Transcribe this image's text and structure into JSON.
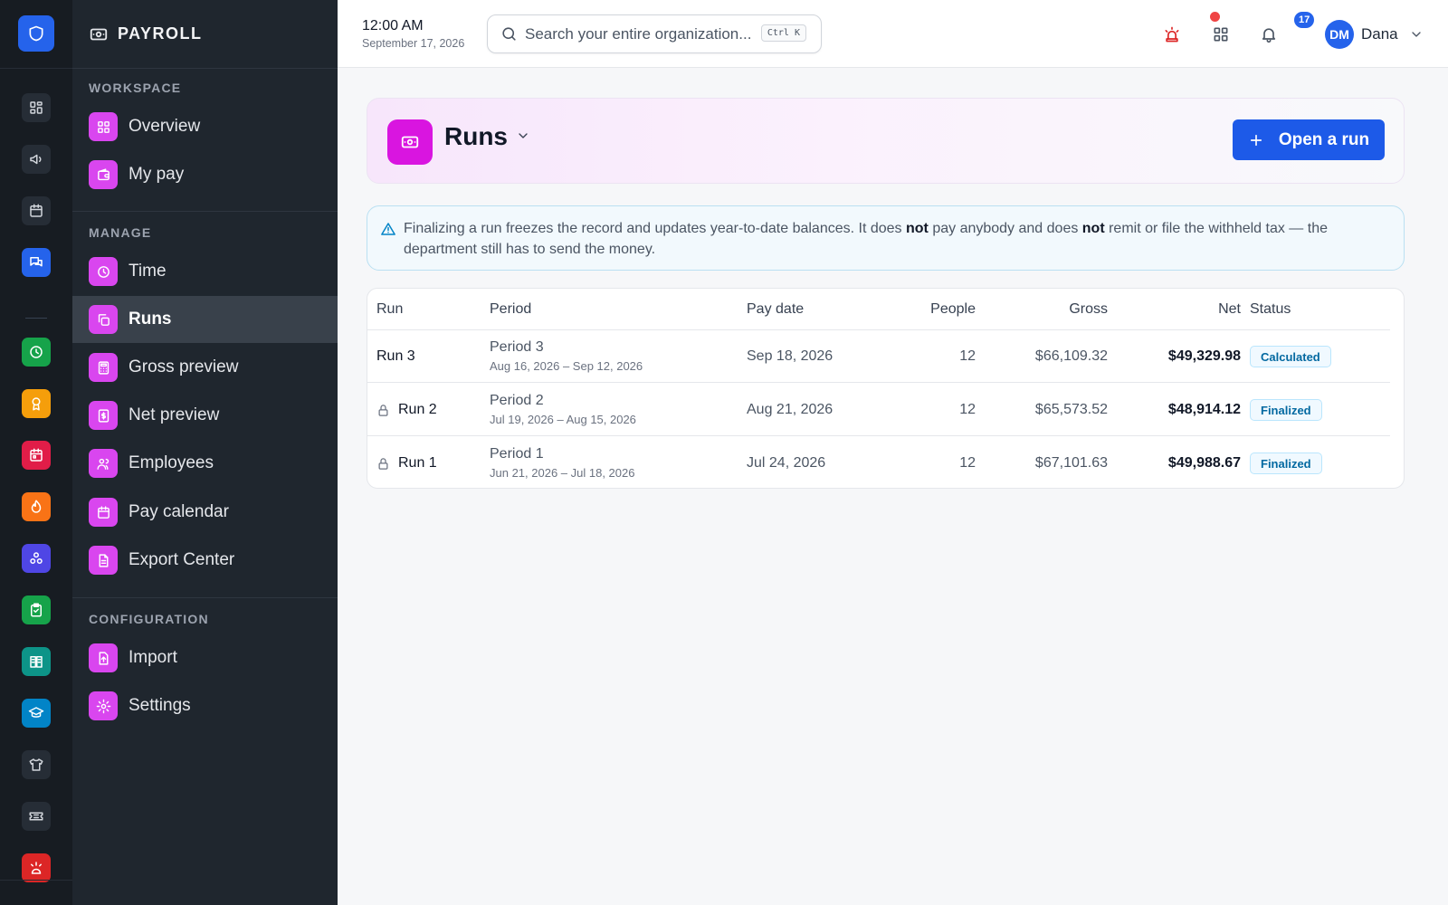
{
  "colors": {
    "accent": "#2563eb",
    "module": "#d946ef",
    "sidebar_bg": "#1f262e",
    "rail_bg": "#171c22",
    "status_text": "#0369a1"
  },
  "rail": {
    "items": [
      {
        "icon": "dashboard-icon",
        "color": "plain"
      },
      {
        "icon": "megaphone-icon",
        "color": "plain"
      },
      {
        "icon": "calendar-icon",
        "color": "plain"
      },
      {
        "icon": "chat-icon",
        "color": "#2563eb"
      },
      {
        "icon": "clock-icon",
        "color": "#16a34a"
      },
      {
        "icon": "award-icon",
        "color": "#f59e0b"
      },
      {
        "icon": "calendar-event-icon",
        "color": "#e11d48"
      },
      {
        "icon": "flame-icon",
        "color": "#f97316"
      },
      {
        "icon": "hierarchy-icon",
        "color": "#4f46e5"
      },
      {
        "icon": "clipboard-check-icon",
        "color": "#16a34a"
      },
      {
        "icon": "book-icon",
        "color": "#0d9488"
      },
      {
        "icon": "graduation-cap-icon",
        "color": "#0284c7"
      },
      {
        "icon": "shirt-icon",
        "color": "plain"
      },
      {
        "icon": "ticket-icon",
        "color": "plain"
      },
      {
        "icon": "alert-icon",
        "color": "#dc2626"
      }
    ]
  },
  "sidebar": {
    "title": "PAYROLL",
    "sections": [
      {
        "label": "WORKSPACE",
        "items": [
          {
            "label": "Overview",
            "icon": "grid-icon"
          },
          {
            "label": "My pay",
            "icon": "wallet-icon"
          }
        ]
      },
      {
        "label": "MANAGE",
        "items": [
          {
            "label": "Time",
            "icon": "clock-icon"
          },
          {
            "label": "Runs",
            "icon": "copy-icon",
            "active": true
          },
          {
            "label": "Gross preview",
            "icon": "calculator-icon"
          },
          {
            "label": "Net preview",
            "icon": "dollar-doc-icon"
          },
          {
            "label": "Employees",
            "icon": "users-icon"
          },
          {
            "label": "Pay calendar",
            "icon": "calendar-icon"
          },
          {
            "label": "Export Center",
            "icon": "file-icon"
          }
        ]
      },
      {
        "label": "CONFIGURATION",
        "items": [
          {
            "label": "Import",
            "icon": "upload-icon"
          },
          {
            "label": "Settings",
            "icon": "gear-icon"
          }
        ]
      }
    ]
  },
  "topbar": {
    "time": "12:00 AM",
    "date": "September 17, 2026",
    "search_placeholder": "Search your entire organization...",
    "search_shortcut": "Ctrl K",
    "notification_count": "17",
    "user_initials": "DM",
    "user_name": "Dana"
  },
  "page": {
    "title": "Runs",
    "open_run_label": "Open a run",
    "notice": {
      "part1": "Finalizing a run freezes the record and updates year-to-date balances. It does ",
      "bold1": "not",
      "part2": " pay anybody and does ",
      "bold2": "not",
      "part3": " remit or file the withheld tax — the department still has to send the money."
    }
  },
  "table": {
    "headers": {
      "run": "Run",
      "period": "Period",
      "pay_date": "Pay date",
      "people": "People",
      "gross": "Gross",
      "net": "Net",
      "status": "Status"
    },
    "rows": [
      {
        "run": "Run 3",
        "locked": false,
        "period": "Period 3",
        "range": "Aug 16, 2026 – Sep 12, 2026",
        "pay_date": "Sep 18, 2026",
        "people": "12",
        "gross": "$66,109.32",
        "net": "$49,329.98",
        "status": "Calculated"
      },
      {
        "run": "Run 2",
        "locked": true,
        "period": "Period 2",
        "range": "Jul 19, 2026 – Aug 15, 2026",
        "pay_date": "Aug 21, 2026",
        "people": "12",
        "gross": "$65,573.52",
        "net": "$48,914.12",
        "status": "Finalized"
      },
      {
        "run": "Run 1",
        "locked": true,
        "period": "Period 1",
        "range": "Jun 21, 2026 – Jul 18, 2026",
        "pay_date": "Jul 24, 2026",
        "people": "12",
        "gross": "$67,101.63",
        "net": "$49,988.67",
        "status": "Finalized"
      }
    ]
  }
}
